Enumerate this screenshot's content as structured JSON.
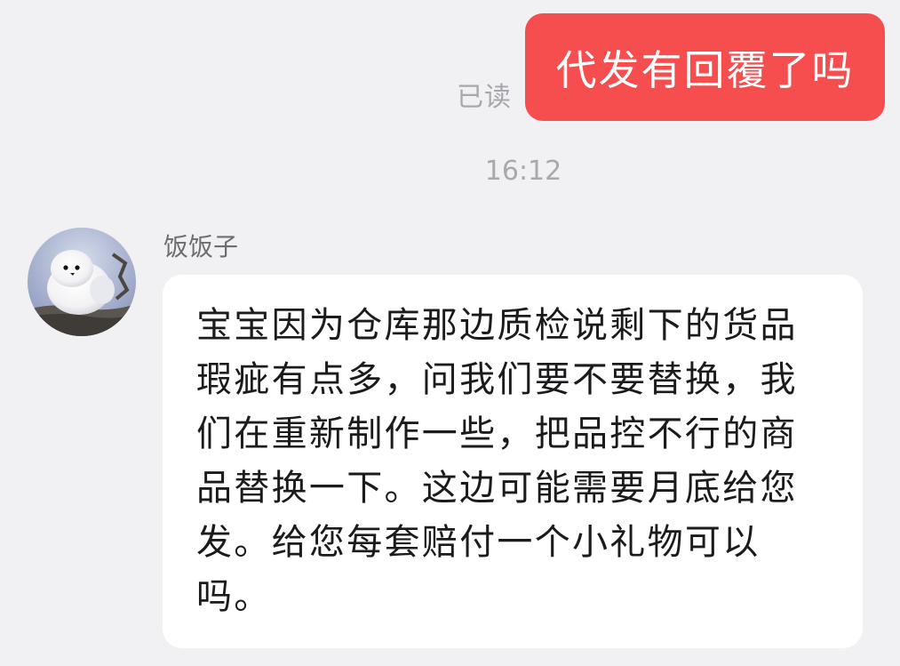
{
  "chat": {
    "outgoing": {
      "read_status": "已读",
      "text": "代发有回覆了吗"
    },
    "timestamp": "16:12",
    "incoming": {
      "sender_name": "饭饭子",
      "avatar_icon": "white-bird-avatar",
      "text": "宝宝因为仓库那边质检说剩下的货品瑕疵有点多，问我们要不要替换，我们在重新制作一些，把品控不行的商品替换一下。这边可能需要月底给您发。给您每套赔付一个小礼物可以吗。"
    }
  },
  "colors": {
    "background": "#f1f1f4",
    "outgoing_bubble": "#f64d4f",
    "incoming_bubble": "#ffffff",
    "meta_text": "#a7a7ad"
  }
}
